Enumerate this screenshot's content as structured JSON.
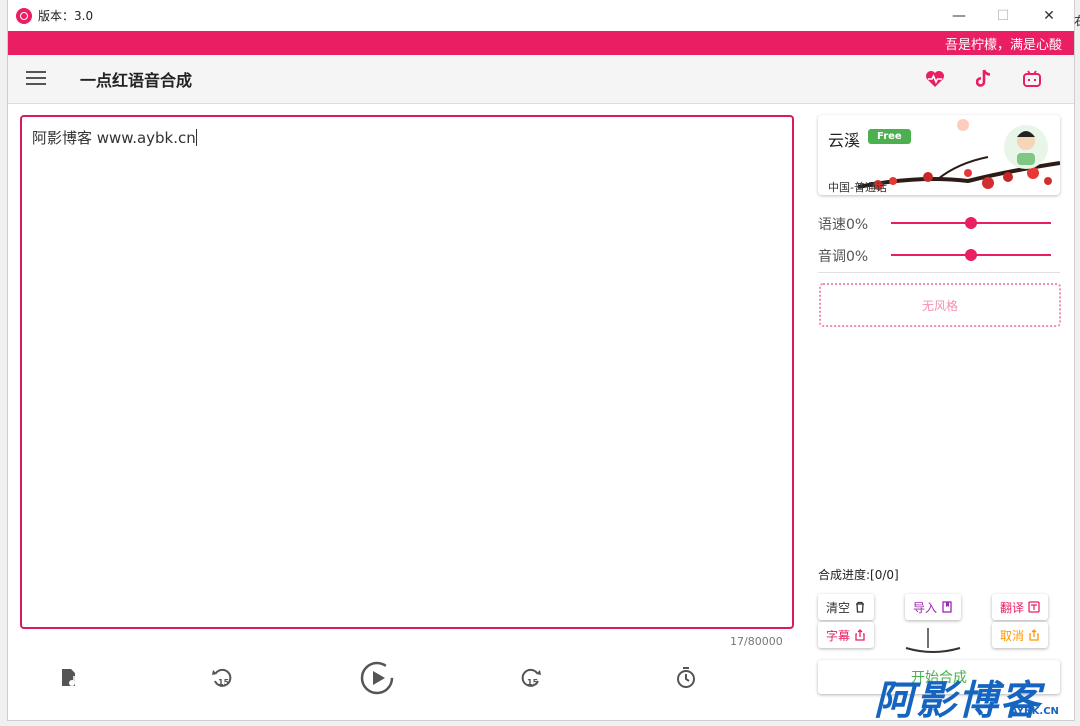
{
  "window": {
    "title": "版本：3.0",
    "minimize_label": "—",
    "maximize_label": "☐",
    "close_label": "✕"
  },
  "banner": {
    "text": "吾是柠檬，满是心酸"
  },
  "appbar": {
    "title": "一点红语音合成",
    "icons": [
      "menu-icon",
      "heart-pulse-icon",
      "tiktok-icon",
      "bilibili-icon"
    ]
  },
  "editor": {
    "text": "阿影博客  www.aybk.cn",
    "counter": "17/80000"
  },
  "bottom_controls": [
    "audio-file-icon",
    "rewind-15-icon",
    "play-icon",
    "forward-15-icon",
    "timer-icon"
  ],
  "voice": {
    "name": "云溪",
    "badge": "Free",
    "region": "中国-普通话"
  },
  "sliders": {
    "speed": {
      "label": "语速0%",
      "value_fraction": 0.5
    },
    "pitch": {
      "label": "音调0%",
      "value_fraction": 0.5
    }
  },
  "style_box": {
    "label": "无风格"
  },
  "progress": {
    "text": "合成进度:[0/0]"
  },
  "actions": {
    "clear": "清空",
    "import": "导入",
    "translate": "翻译",
    "subtitle": "字幕",
    "cancel": "取消",
    "start": "开始合成"
  },
  "watermark": {
    "text": "阿影博客",
    "sub": "AYBK.CN"
  },
  "colors": {
    "accent": "#e91e63",
    "free_badge": "#4caf50",
    "import": "#9c27b0",
    "cancel": "#ff9800"
  }
}
